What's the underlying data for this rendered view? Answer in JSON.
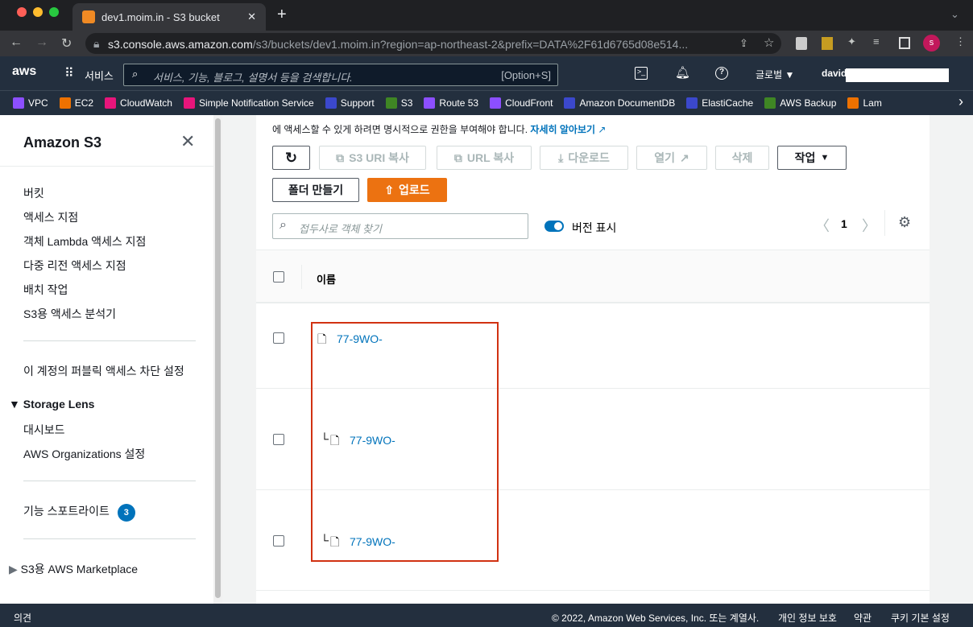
{
  "browser": {
    "tab_title": "dev1.moim.in - S3 bucket",
    "url_host": "s3.console.aws.amazon.com",
    "url_path": "/s3/buckets/dev1.moim.in?region=ap-northeast-2&prefix=DATA%2F61d6765d08e514...",
    "profile_initial": "s"
  },
  "awsnav": {
    "services": "서비스",
    "search_placeholder": "서비스, 기능, 블로그, 설명서 등을 검색합니다.",
    "shortcut": "[Option+S]",
    "region": "글로벌 ▼",
    "user": "david"
  },
  "bookmarks": [
    {
      "label": "VPC",
      "color": "#8c4fff"
    },
    {
      "label": "EC2",
      "color": "#ed7100"
    },
    {
      "label": "CloudWatch",
      "color": "#e7157b"
    },
    {
      "label": "Simple Notification Service",
      "color": "#e7157b"
    },
    {
      "label": "Support",
      "color": "#3b48cc"
    },
    {
      "label": "S3",
      "color": "#3f8624"
    },
    {
      "label": "Route 53",
      "color": "#8c4fff"
    },
    {
      "label": "CloudFront",
      "color": "#8c4fff"
    },
    {
      "label": "Amazon DocumentDB",
      "color": "#3b48cc"
    },
    {
      "label": "ElastiCache",
      "color": "#3b48cc"
    },
    {
      "label": "AWS Backup",
      "color": "#3f8624"
    },
    {
      "label": "Lam",
      "color": "#ed7100"
    }
  ],
  "sidebar": {
    "title": "Amazon S3",
    "items": [
      "버킷",
      "액세스 지점",
      "객체 Lambda 액세스 지점",
      "다중 리전 액세스 지점",
      "배치 작업",
      "S3용 액세스 분석기"
    ],
    "block_public": "이 계정의 퍼블릭 액세스 차단 설정",
    "storage_lens": "Storage Lens",
    "lens_items": [
      "대시보드",
      "AWS Organizations 설정"
    ],
    "spotlight": "기능 스포트라이트",
    "spotlight_badge": "3",
    "marketplace": "S3용 AWS Marketplace"
  },
  "main": {
    "notice": "에 액세스할 수 있게 하려면 명시적으로 권한을 부여해야 합니다.",
    "learn_more": "자세히 알아보기",
    "buttons": {
      "copy_s3_uri": "S3 URI 복사",
      "copy_url": "URL 복사",
      "download": "다운로드",
      "open": "열기",
      "delete": "삭제",
      "actions": "작업",
      "create_folder": "폴더 만들기",
      "upload": "업로드"
    },
    "search_placeholder": "접두사로 객체 찾기",
    "show_versions": "버전 표시",
    "show_versions_on": true,
    "page": "1",
    "column_name": "이름",
    "rows": [
      {
        "name": "77-9WO-",
        "version": false
      },
      {
        "name": "77-9WO-",
        "version": true
      },
      {
        "name": "77-9WO-",
        "version": true
      }
    ]
  },
  "footer": {
    "feedback": "의견",
    "copyright": "© 2022, Amazon Web Services, Inc. 또는 계열사.",
    "privacy": "개인 정보 보호",
    "terms": "약관",
    "cookies": "쿠키 기본 설정"
  }
}
